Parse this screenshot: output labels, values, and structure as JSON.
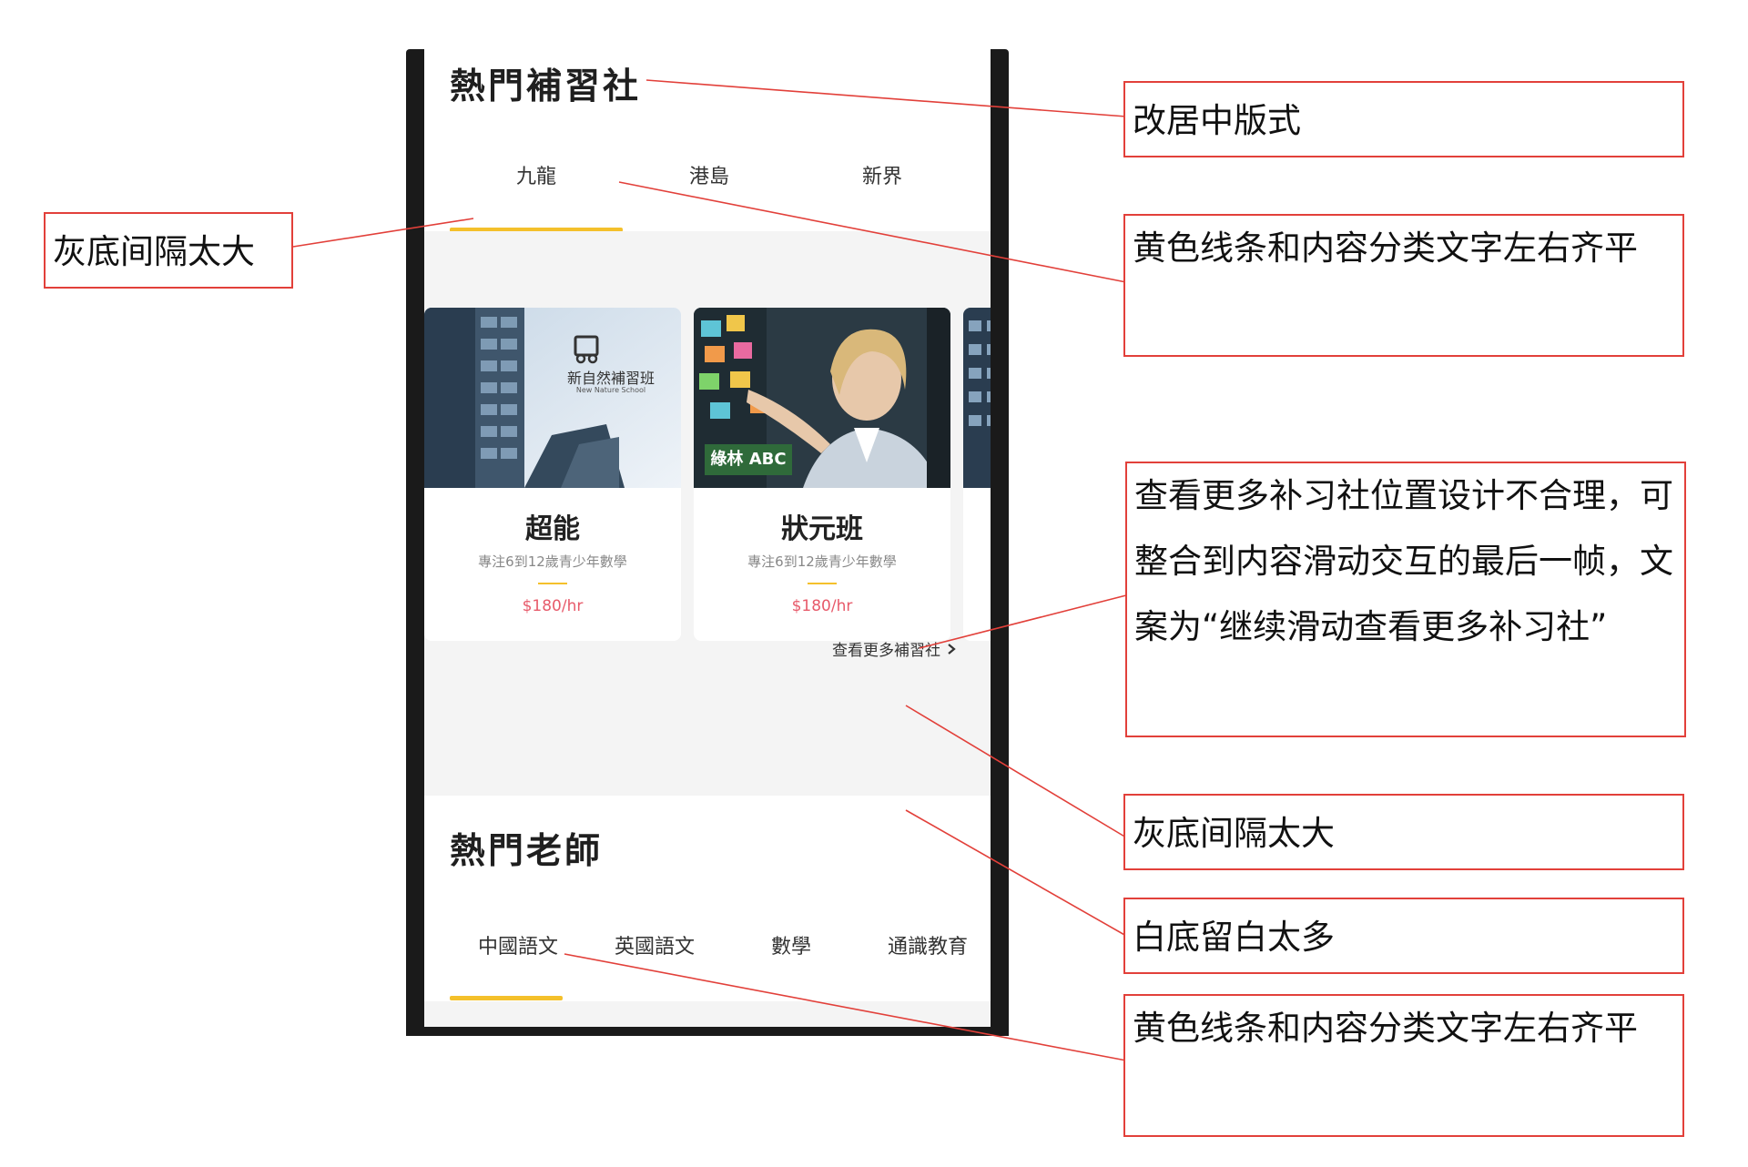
{
  "hot_tutorials": {
    "title": "熱門補習社",
    "tabs": [
      "九龍",
      "港島",
      "新界"
    ],
    "active_tab": 0,
    "cards": [
      {
        "image_caption": "新自然補習班",
        "image_subcaption": "New Nature School",
        "name": "超能",
        "desc": "專注6到12歲青少年數學",
        "price": "$180/hr"
      },
      {
        "image_caption": "綠林 ABC",
        "image_subcaption": "",
        "name": "狀元班",
        "desc": "專注6到12歲青少年數學",
        "price": "$180/hr"
      },
      {
        "image_caption": "",
        "image_subcaption": "",
        "name": "",
        "desc": "",
        "price": ""
      }
    ],
    "view_more": "查看更多補習社"
  },
  "hot_teachers": {
    "title": "熱門老師",
    "tabs": [
      "中國語文",
      "英國語文",
      "數學",
      "通識教育"
    ],
    "active_tab": 0
  },
  "annotations": [
    {
      "text": "改居中版式"
    },
    {
      "text": "灰底间隔太大"
    },
    {
      "text": "黄色线条和内容分类文字左右齐平"
    },
    {
      "text": "查看更多补习社位置设计不合理，可整合到内容滑动交互的最后一帧，文案为“继续滑动查看更多补习社”"
    },
    {
      "text": "灰底间隔太大"
    },
    {
      "text": "白底留白太多"
    },
    {
      "text": "黄色线条和内容分类文字左右齐平"
    }
  ],
  "colors": {
    "accent_yellow": "#f4c02b",
    "annotation_red": "#e2403a",
    "price_pink": "#e75a6a",
    "band_gray": "#f4f4f4"
  },
  "icons": {
    "view_more": "chevron-right-icon"
  }
}
